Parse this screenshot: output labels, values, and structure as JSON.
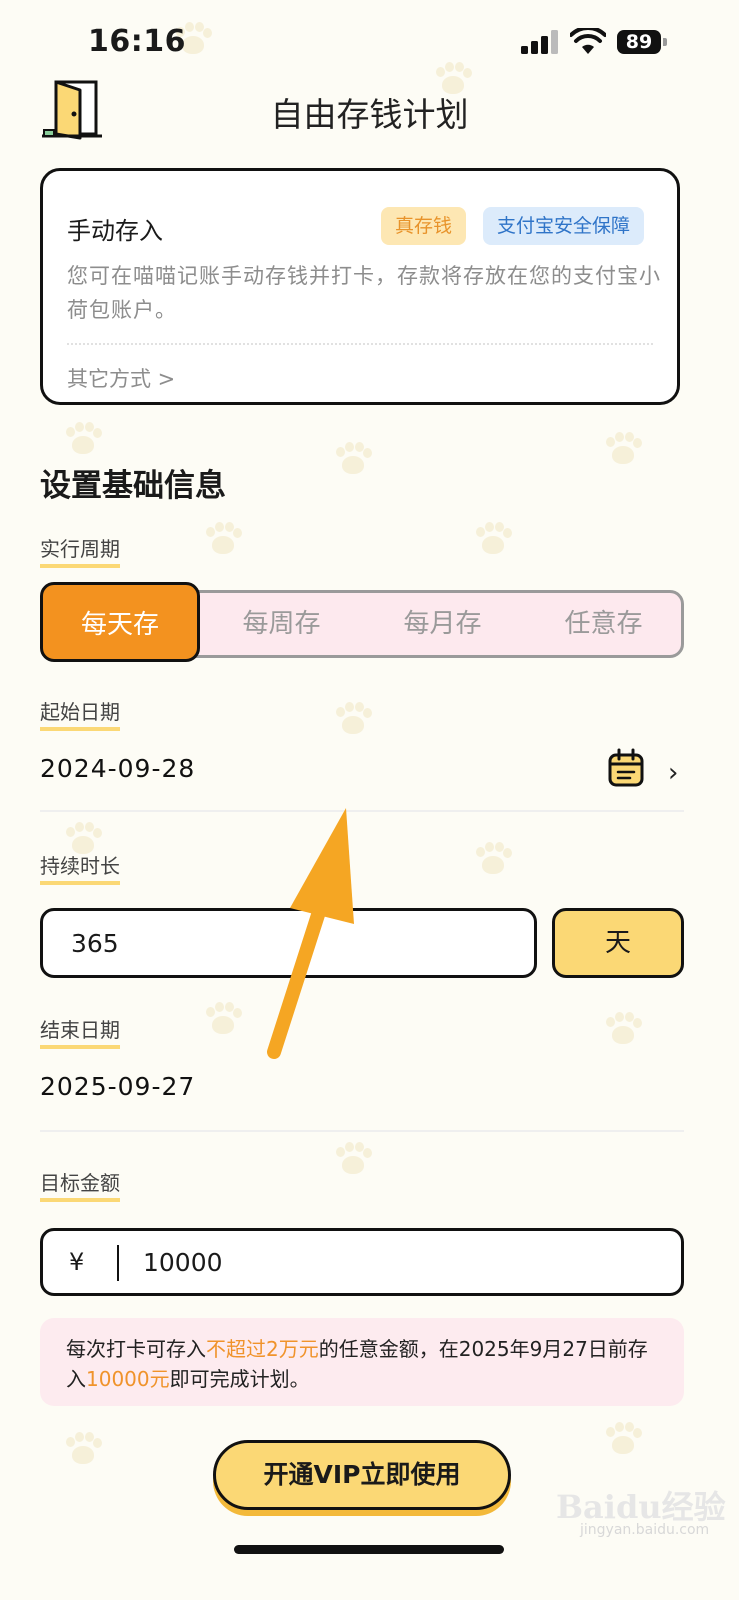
{
  "status_bar": {
    "time": "16:16",
    "battery": "89"
  },
  "header": {
    "title": "自由存钱计划"
  },
  "deposit_card": {
    "title": "手动存入",
    "badge_real": "真存钱",
    "badge_safe": "支付宝安全保障",
    "description": "您可在喵喵记账手动存钱并打卡，存款将存放在您的支付宝小荷包账户。",
    "other_methods": "其它方式 >"
  },
  "basic_info": {
    "section_title": "设置基础信息",
    "period_label": "实行周期",
    "period_options": [
      "每天存",
      "每周存",
      "每月存",
      "任意存"
    ],
    "period_selected": "每天存",
    "start_date_label": "起始日期",
    "start_date": "2024-09-28",
    "duration_label": "持续时长",
    "duration_value": "365",
    "duration_unit": "天",
    "end_date_label": "结束日期",
    "end_date": "2025-09-27",
    "target_label": "目标金额",
    "currency_symbol": "¥",
    "target_amount": "10000"
  },
  "note": {
    "part1": "每次打卡可存入",
    "limit": "不超过2万元",
    "part2": "的任意金额，在2025年9月27日前存入",
    "amount": "10000元",
    "part3": "即可完成计划。"
  },
  "vip_button": {
    "label": "开通VIP立即使用"
  },
  "watermark": {
    "brand": "Baidu经验",
    "url": "jingyan.baidu.com"
  },
  "colors": {
    "accent_orange": "#f3921f",
    "accent_yellow": "#fbd875",
    "note_bg": "#fdebef"
  }
}
